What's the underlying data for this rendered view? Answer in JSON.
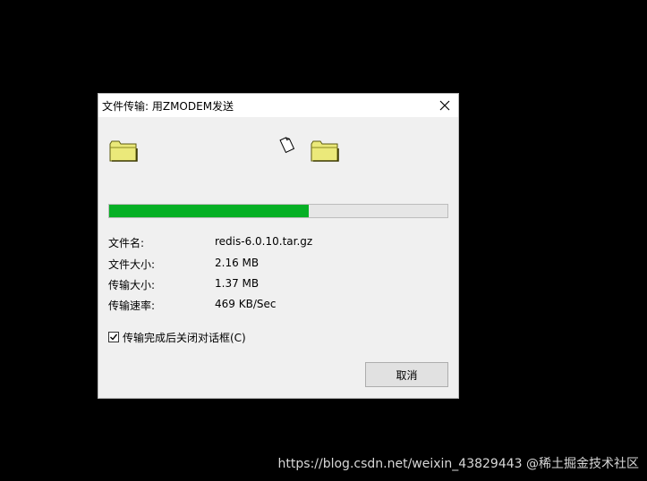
{
  "window": {
    "title": "文件传输: 用ZMODEM发送",
    "close_icon": "close-icon"
  },
  "transfer": {
    "progress_fraction": 0.59,
    "progress_color": "#06b025",
    "source_icon": "folder-icon",
    "file_icon": "file-icon",
    "dest_icon": "folder-icon"
  },
  "fields": [
    {
      "label": "文件名:",
      "value": "redis-6.0.10.tar.gz"
    },
    {
      "label": "文件大小:",
      "value": "2.16 MB"
    },
    {
      "label": "传输大小:",
      "value": "1.37 MB"
    },
    {
      "label": "传输速率:",
      "value": "469 KB/Sec"
    }
  ],
  "close_on_complete": {
    "label": "传输完成后关闭对话框(C)",
    "checked": true
  },
  "buttons": {
    "cancel": "取消"
  },
  "watermark": "https://blog.csdn.net/weixin_43829443 @稀土掘金技术社区"
}
